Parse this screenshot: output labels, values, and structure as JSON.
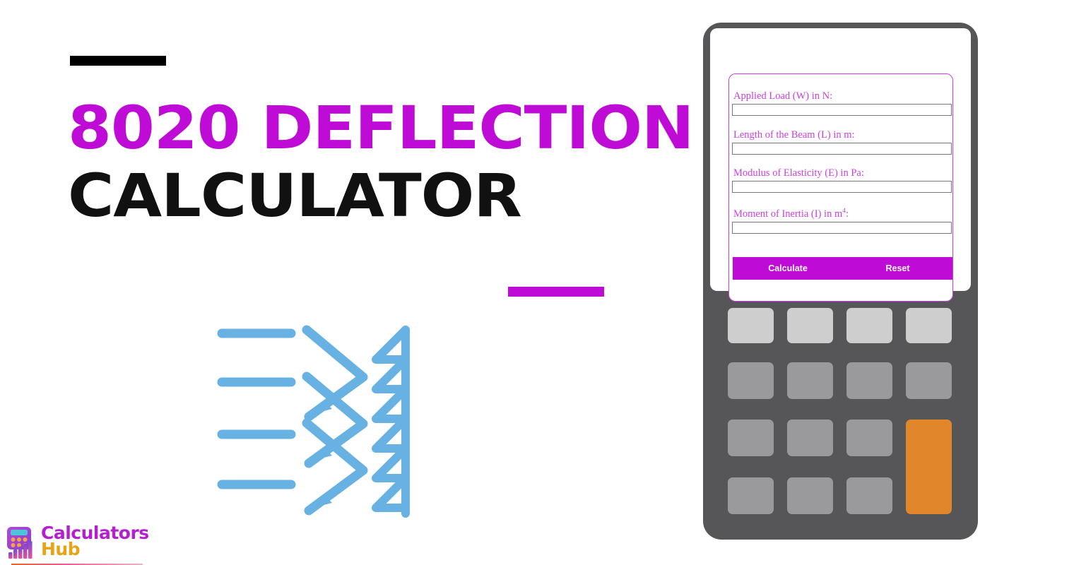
{
  "page": {
    "title_line_1": "8020 DEFLECTION",
    "title_line_2": "CALCULATOR",
    "accent_magenta": "#bf0bd6",
    "accent_black": "#000000",
    "illustration_blue": "#67b2e3"
  },
  "decor": {
    "black_dash_name": "black-accent-dash",
    "magenta_dash_name": "magenta-accent-dash"
  },
  "illustration": {
    "name": "beam-deflection-icon",
    "description": "beam deflection diagram with load arrows and fixed wall hatching",
    "load_bars": 4,
    "hatch_triangles": 6
  },
  "calculator": {
    "form": {
      "fields": [
        {
          "label": "Applied Load (W) in N:",
          "value": "",
          "placeholder": ""
        },
        {
          "label": "Length of the Beam (L) in m:",
          "value": "",
          "placeholder": ""
        },
        {
          "label": "Modulus of Elasticity (E) in Pa:",
          "value": "",
          "placeholder": ""
        },
        {
          "label_prefix": "Moment of Inertia (I) in m",
          "label_sup": "4",
          "label_suffix": ":",
          "value": "",
          "placeholder": ""
        }
      ],
      "calculate_label": "Calculate",
      "reset_label": "Reset",
      "border_color": "#cb3fe0",
      "button_bar_color": "#bf0bd6"
    },
    "keypad": {
      "rows": 4,
      "cols": 4,
      "top_row_color": "#cecece",
      "key_color": "#9a9a9c",
      "accent_key_color": "#e2862c",
      "body_color": "#565659"
    }
  },
  "brand": {
    "word_1": "Calculators",
    "word_2": "Hub",
    "word_1_color": "#b41fd0",
    "word_2_color": "#e9a317",
    "icon_name": "calculator-bars-logo-icon"
  }
}
